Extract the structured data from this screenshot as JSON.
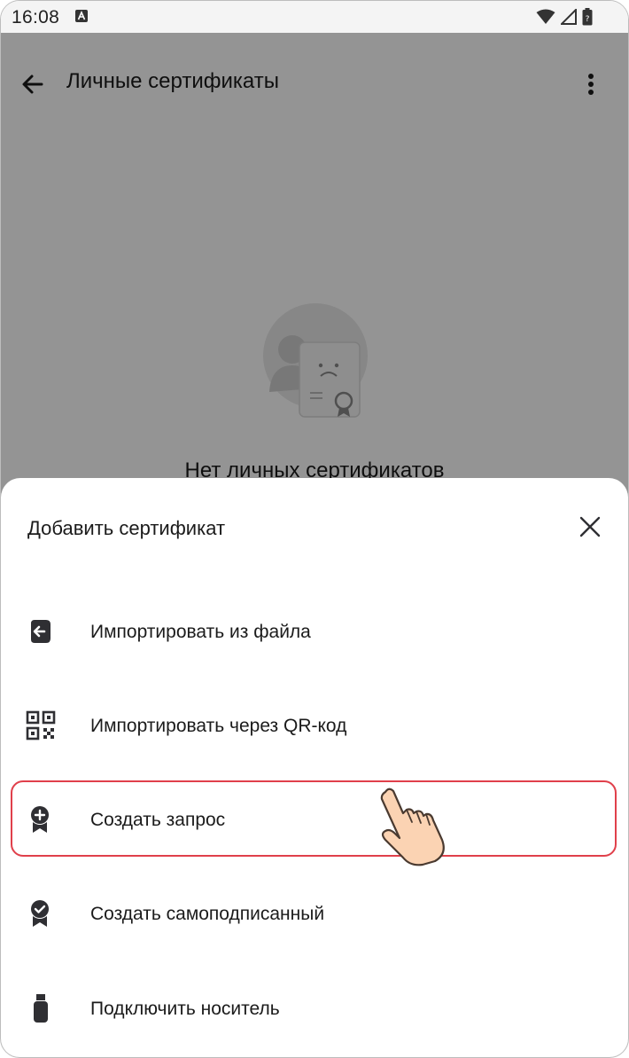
{
  "status_bar": {
    "time": "16:08"
  },
  "app_bar": {
    "title": "Личные сертификаты"
  },
  "empty_state": {
    "text": "Нет личных сертификатов"
  },
  "sheet": {
    "title": "Добавить сертификат",
    "items": [
      {
        "label": "Импортировать из файла",
        "icon": "import-file-icon"
      },
      {
        "label": "Импортировать через QR-код",
        "icon": "qr-code-icon"
      },
      {
        "label": "Создать запрос",
        "icon": "certificate-add-icon"
      },
      {
        "label": "Создать самоподписанный",
        "icon": "certificate-check-icon"
      },
      {
        "label": "Подключить носитель",
        "icon": "usb-token-icon"
      }
    ]
  },
  "colors": {
    "highlight": "#e0404b",
    "scrim": "rgba(0,0,0,0.42)",
    "icon": "#2f2f33"
  }
}
